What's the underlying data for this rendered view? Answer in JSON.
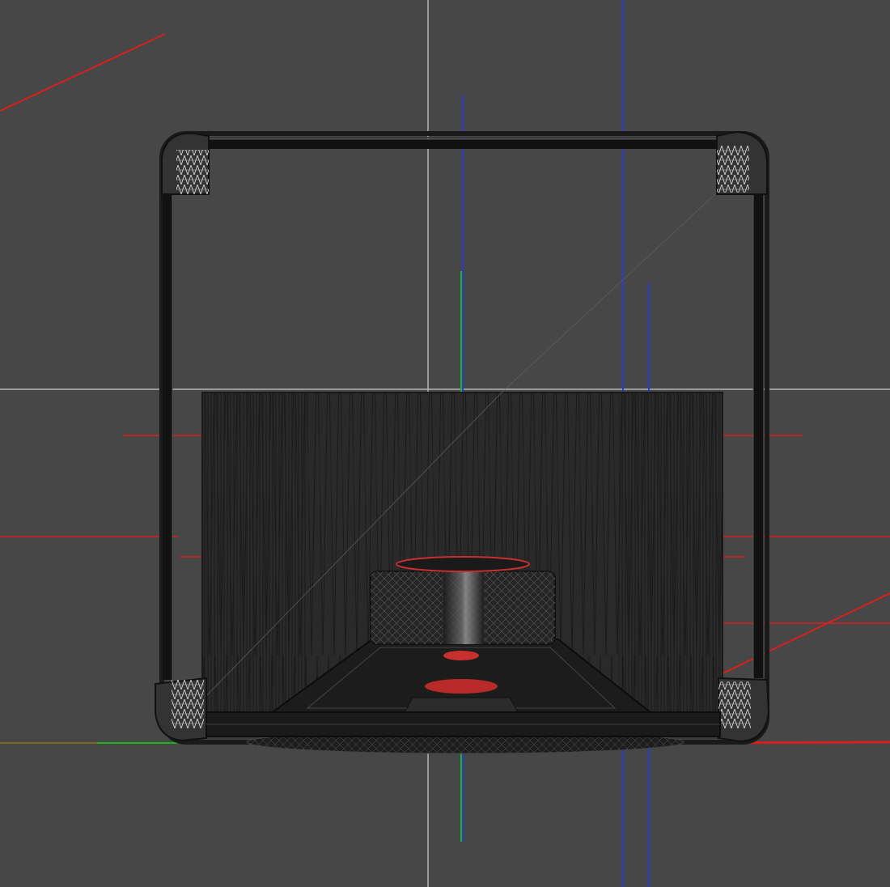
{
  "viewport": {
    "name": "3d-orthographic-viewport",
    "background": "#474747",
    "shading": "wireframe",
    "object": "guitar-amplifier-cabinet"
  },
  "colors": {
    "background": "#474747",
    "grid_axis": "#b4b4b4",
    "x_axis": "#d81e1e",
    "y_axis": "#18b818",
    "z_axis": "#2a3ad0",
    "wire_dark": "#141414",
    "wire_mid": "#303030",
    "wire_light": "#dedede",
    "accent_red": "#c83030"
  },
  "gizmos": {
    "helper_lines": [
      "x-axis-helper",
      "y-axis-helper",
      "z-axis-helper"
    ]
  }
}
